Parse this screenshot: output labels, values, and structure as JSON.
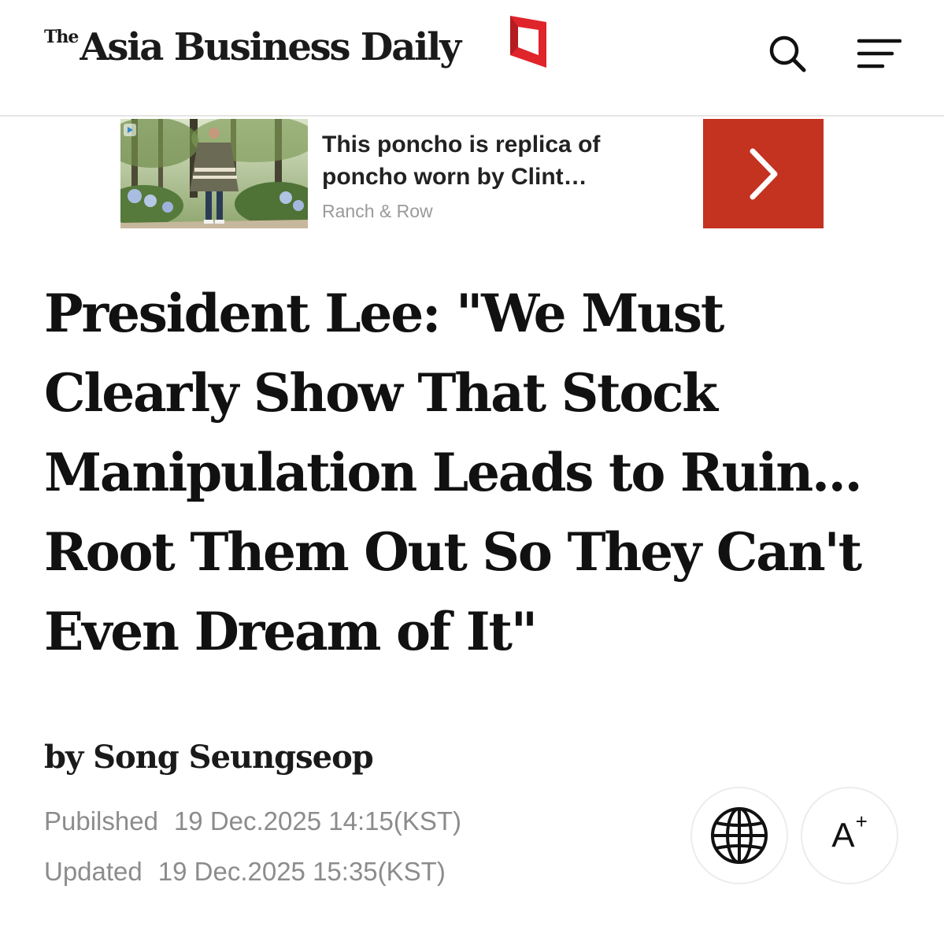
{
  "header": {
    "logo_the": "The",
    "logo_name": "Asia Business Daily",
    "logo_mark_color": "#e0242b",
    "search_icon": "search-icon",
    "menu_icon": "hamburger-menu-icon"
  },
  "ad": {
    "title": "This poncho is replica of poncho worn by Clint…",
    "source": "Ranch & Row",
    "cta_icon": "chevron-right-icon",
    "cta_color": "#c43220",
    "ad_badge_icon": "ad-choices-icon"
  },
  "article": {
    "headline": "President Lee: \"We Must Clearly Show That Stock Manipulation Leads to Ruin... Root Them Out So They Can't Even Dream of It\"",
    "byline": "by Song Seungseop",
    "published_label": "Pubilshed",
    "published_value": "19 Dec.2025 14:15(KST)",
    "updated_label": "Updated",
    "updated_value": "19 Dec.2025 15:35(KST)"
  },
  "actions": {
    "language_icon": "globe-icon",
    "font_size_label": "A",
    "font_size_sup": "+"
  }
}
